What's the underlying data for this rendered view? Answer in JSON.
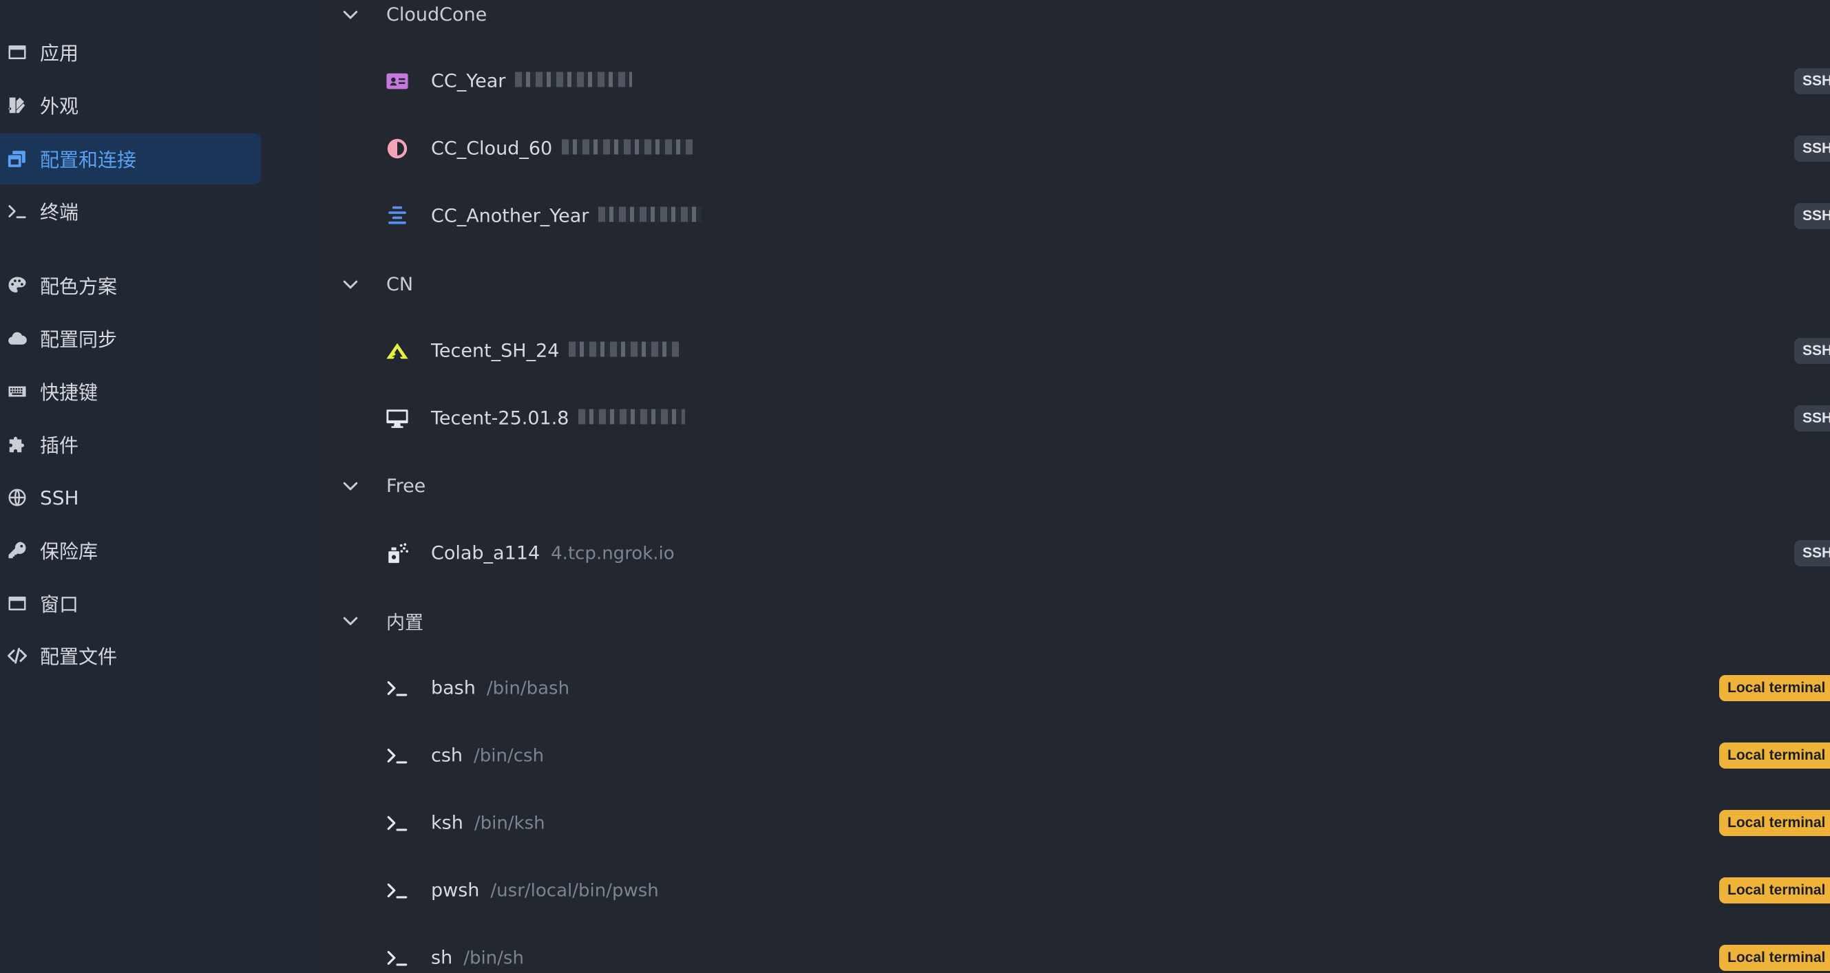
{
  "sidebar": {
    "items": [
      {
        "label": "应用",
        "icon": "window-icon",
        "active": false
      },
      {
        "label": "外观",
        "icon": "appearance-icon",
        "active": false
      },
      {
        "label": "配置和连接",
        "icon": "profiles-icon",
        "active": true
      },
      {
        "label": "终端",
        "icon": "terminal-icon",
        "active": false
      },
      {
        "label": "配色方案",
        "icon": "palette-icon",
        "active": false
      },
      {
        "label": "配置同步",
        "icon": "cloud-icon",
        "active": false
      },
      {
        "label": "快捷键",
        "icon": "keyboard-icon",
        "active": false
      },
      {
        "label": "插件",
        "icon": "puzzle-icon",
        "active": false
      },
      {
        "label": "SSH",
        "icon": "globe-icon",
        "active": false
      },
      {
        "label": "保险库",
        "icon": "key-icon",
        "active": false
      },
      {
        "label": "窗口",
        "icon": "window-icon",
        "active": false
      },
      {
        "label": "配置文件",
        "icon": "code-icon",
        "active": false
      }
    ]
  },
  "groups": [
    {
      "label": "CloudCone",
      "items": [
        {
          "name": "CC_Year",
          "desc": "",
          "badge": "SSH",
          "icon": "id-card-icon",
          "icon_color": "#c678dd"
        },
        {
          "name": "CC_Cloud_60",
          "desc": "",
          "badge": "SSH",
          "icon": "half-circle-icon",
          "icon_color": "#f4a3b9"
        },
        {
          "name": "CC_Another_Year",
          "desc": "",
          "badge": "SSH",
          "icon": "align-center-icon",
          "icon_color": "#5a8df0"
        }
      ]
    },
    {
      "label": "CN",
      "items": [
        {
          "name": "Tecent_SH_24",
          "desc": "",
          "badge": "SSH",
          "icon": "tencent-icon",
          "icon_color": "#e8f23c"
        },
        {
          "name": "Tecent-25.01.8",
          "desc": "",
          "badge": "SSH",
          "icon": "desktop-icon",
          "icon_color": "#e6e8ec"
        }
      ]
    },
    {
      "label": "Free",
      "items": [
        {
          "name": "Colab_a114",
          "desc": "4.tcp.ngrok.io",
          "badge": "SSH",
          "icon": "spray-can-icon",
          "icon_color": "#e6e8ec"
        }
      ]
    },
    {
      "label": "内置",
      "items": [
        {
          "name": "bash",
          "desc": "/bin/bash",
          "badge": "Local terminal",
          "icon": "terminal-icon",
          "icon_color": "#e6e8ec"
        },
        {
          "name": "csh",
          "desc": "/bin/csh",
          "badge": "Local terminal",
          "icon": "terminal-icon",
          "icon_color": "#e6e8ec"
        },
        {
          "name": "ksh",
          "desc": "/bin/ksh",
          "badge": "Local terminal",
          "icon": "terminal-icon",
          "icon_color": "#e6e8ec"
        },
        {
          "name": "pwsh",
          "desc": "/usr/local/bin/pwsh",
          "badge": "Local terminal",
          "icon": "terminal-icon",
          "icon_color": "#e6e8ec"
        },
        {
          "name": "sh",
          "desc": "/bin/sh",
          "badge": "Local terminal",
          "icon": "terminal-icon",
          "icon_color": "#e6e8ec"
        }
      ]
    }
  ],
  "colors": {
    "accent": "#5aa0f0",
    "active_bg": "#1b3558",
    "ssh_badge": "#3a404b",
    "local_badge": "#f0b33a"
  }
}
